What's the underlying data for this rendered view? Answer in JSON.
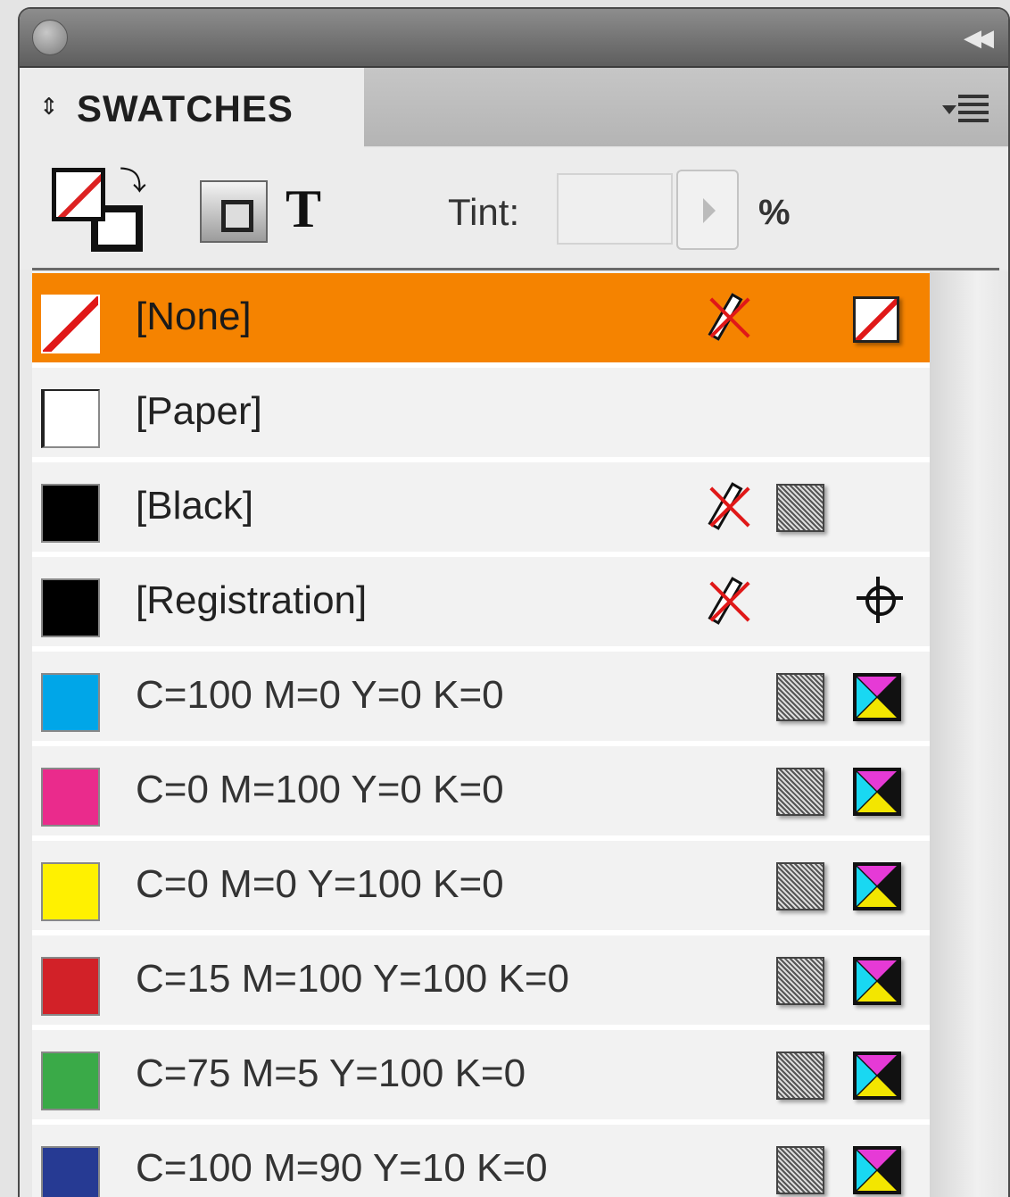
{
  "panel": {
    "tab_arrows": "⇕",
    "title": "SWATCHES",
    "collapse_glyph": "◀◀"
  },
  "toolbar": {
    "text_button": "T",
    "tint_label": "Tint:",
    "tint_value": "",
    "tint_unit": "%"
  },
  "swatches": [
    {
      "name": "[None]",
      "color": "none",
      "selected": true,
      "non_editable": true,
      "type_icon": "none-swatch-icon"
    },
    {
      "name": "[Paper]",
      "color": "#ffffff",
      "selected": false,
      "non_editable": false,
      "type_icon": ""
    },
    {
      "name": "[Black]",
      "color": "#000000",
      "selected": false,
      "non_editable": true,
      "type_icon": "process-color-icon"
    },
    {
      "name": "[Registration]",
      "color": "#000000",
      "selected": false,
      "non_editable": true,
      "type_icon": "registration-icon"
    },
    {
      "name": "C=100 M=0 Y=0 K=0",
      "color": "#00a6e8",
      "selected": false,
      "non_editable": false,
      "type_icon": "cmyk-icon"
    },
    {
      "name": "C=0 M=100 Y=0 K=0",
      "color": "#ea2b8c",
      "selected": false,
      "non_editable": false,
      "type_icon": "cmyk-icon"
    },
    {
      "name": "C=0 M=0 Y=100 K=0",
      "color": "#fff100",
      "selected": false,
      "non_editable": false,
      "type_icon": "cmyk-icon"
    },
    {
      "name": "C=15 M=100 Y=100 K=0",
      "color": "#d22128",
      "selected": false,
      "non_editable": false,
      "type_icon": "cmyk-icon"
    },
    {
      "name": "C=75 M=5 Y=100 K=0",
      "color": "#3aaa48",
      "selected": false,
      "non_editable": false,
      "type_icon": "cmyk-icon"
    },
    {
      "name": "C=100 M=90 Y=10 K=0",
      "color": "#263a93",
      "selected": false,
      "non_editable": false,
      "type_icon": "cmyk-icon"
    }
  ],
  "colors": {
    "selection": "#f58300",
    "none_slash": "#e01818"
  }
}
